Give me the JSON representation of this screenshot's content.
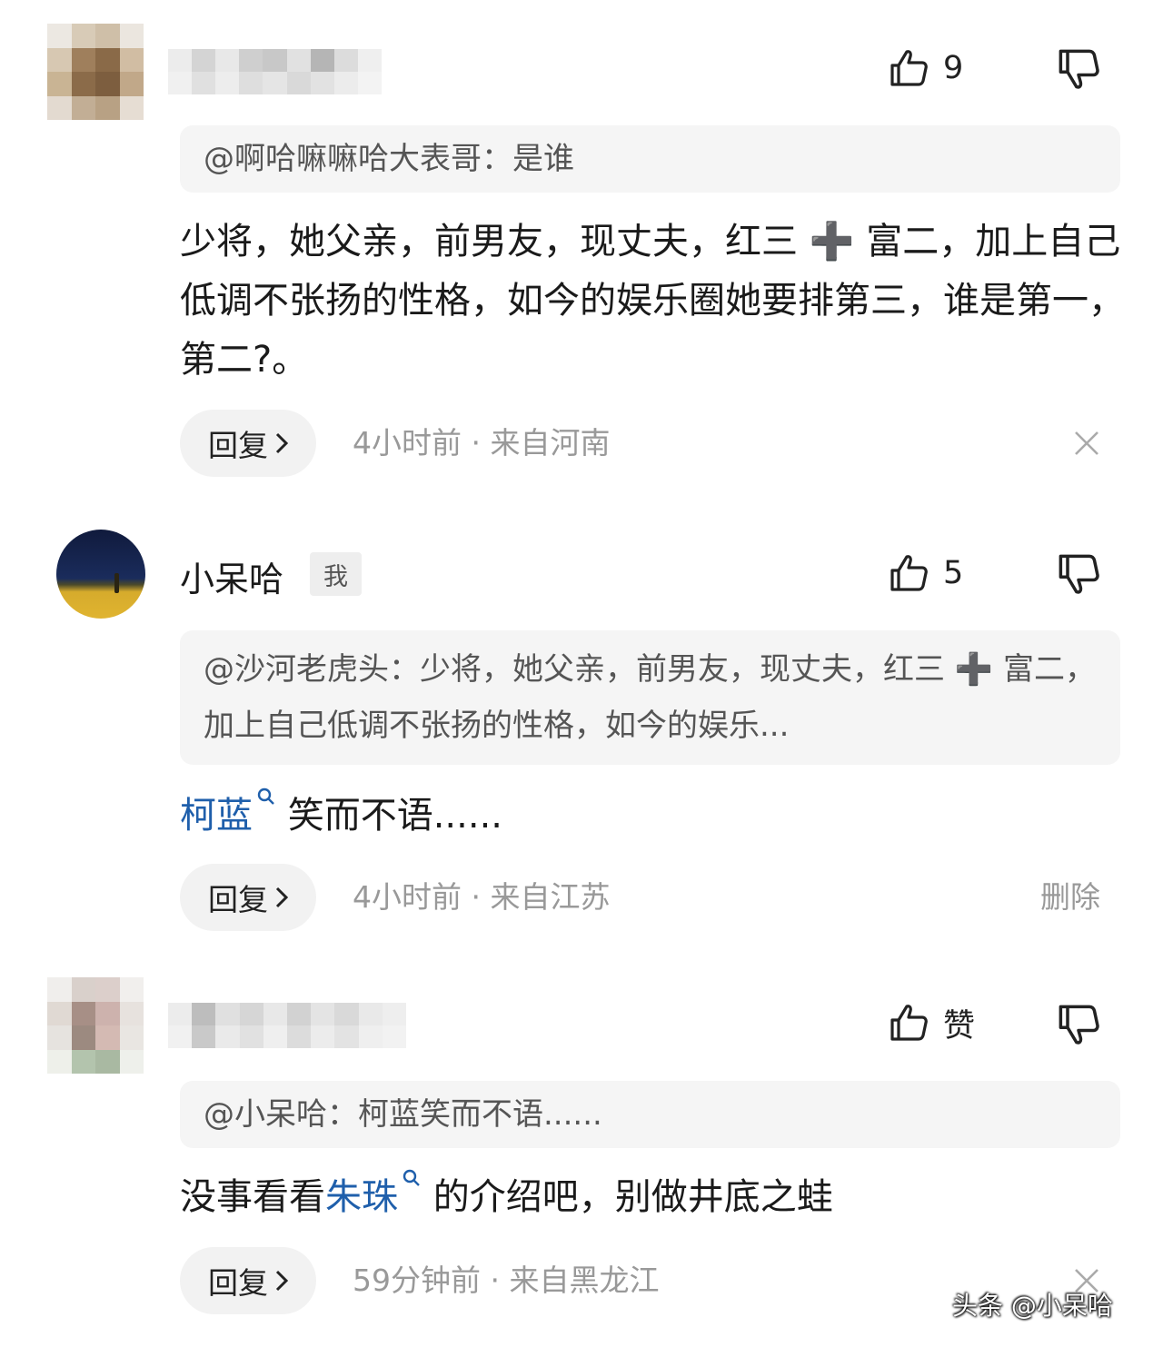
{
  "comments": [
    {
      "username": "",
      "likes": "9",
      "quote": "@啊哈嘛嘛哈大表哥：是谁",
      "body": "少将，她父亲，前男友，现丈夫，红三 ➕ 富二，加上自己低调不张扬的性格，如今的娱乐圈她要排第三，谁是第一，第二?。",
      "reply_label": "回复",
      "reply_icon": "chevron-right-icon",
      "meta": "4小时前 · 来自河南",
      "action": "close-icon"
    },
    {
      "username": "小呆哈",
      "me_tag": "我",
      "likes": "5",
      "quote": "@沙河老虎头：少将，她父亲，前男友，现丈夫，红三 ➕ 富二，加上自己低调不张扬的性格，如今的娱乐...",
      "body_link": "柯蓝",
      "body_rest": "笑而不语......",
      "reply_label": "回复",
      "meta": "4小时前 · 来自江苏",
      "delete_label": "删除"
    },
    {
      "username": "",
      "likes": "赞",
      "quote": "@小呆哈：柯蓝笑而不语......",
      "body_pre": "没事看看",
      "body_link": "朱珠",
      "body_post": "的介绍吧，别做井底之蛙",
      "reply_label": "回复",
      "meta": "59分钟前 · 来自黑龙江",
      "action": "close-icon"
    }
  ],
  "watermark": "头条 @小呆哈",
  "colors": {
    "link": "#1f5fab",
    "meta": "#999999",
    "quote_bg": "#f5f5f5"
  }
}
